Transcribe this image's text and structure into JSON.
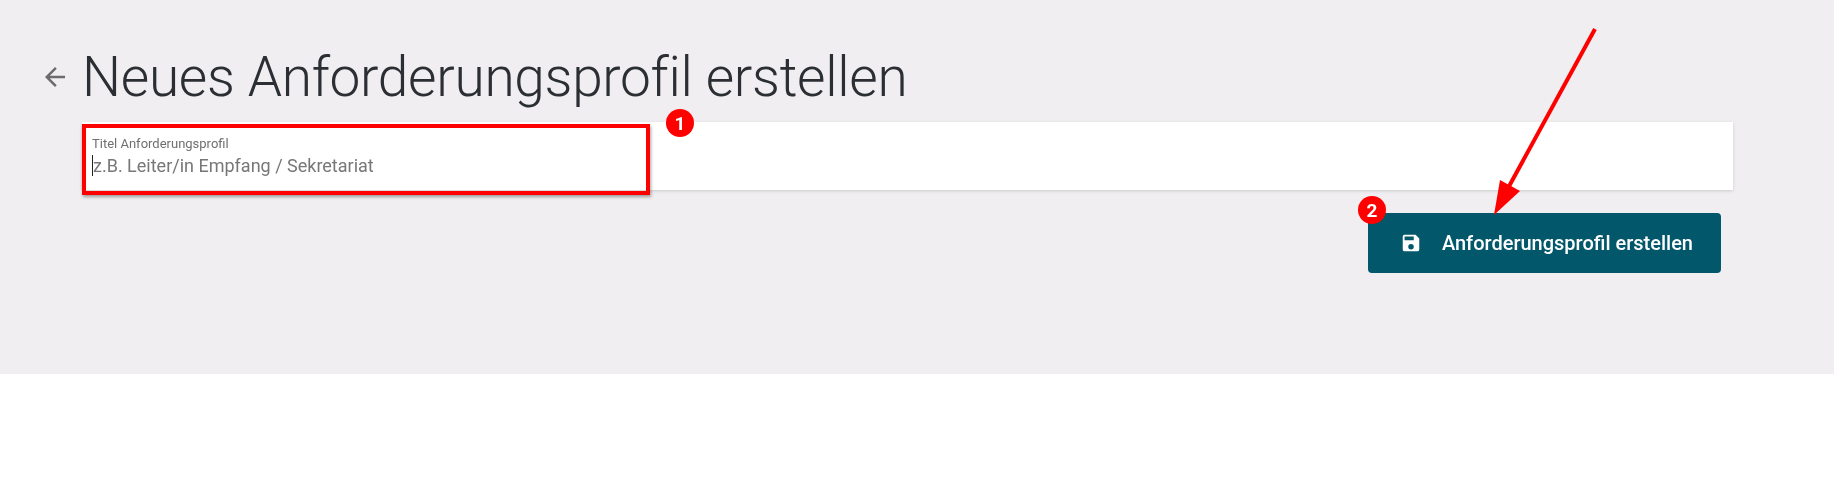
{
  "page_title": "Neues Anforderungsprofil erstellen",
  "title_field": {
    "label": "Titel Anforderungsprofil",
    "placeholder": "z.B. Leiter/in Empfang / Sekretariat"
  },
  "submit_button": {
    "label": "Anforderungsprofil erstellen"
  },
  "annotations": [
    {
      "number": "1"
    },
    {
      "number": "2"
    }
  ]
}
